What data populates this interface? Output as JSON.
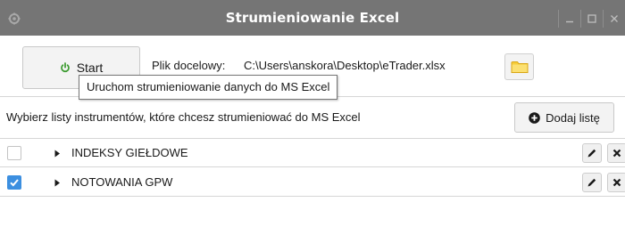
{
  "window": {
    "title": "Strumieniowanie Excel",
    "icon": "gear-icon",
    "controls": [
      "minimize-icon",
      "maximize-icon",
      "close-icon"
    ]
  },
  "toolbar": {
    "start_label": "Start",
    "start_icon": "power-icon",
    "target_label": "Plik docelowy:",
    "target_path": "C:\\Users\\anskora\\Desktop\\eTrader.xlsx",
    "folder_icon": "folder-icon"
  },
  "tooltip": {
    "text": "Uruchom strumieniowanie danych do MS Excel"
  },
  "lists": {
    "instruction": "Wybierz listy instrumentów, które chcesz strumieniować do MS Excel",
    "add_label": "Dodaj listę",
    "add_icon": "plus-circle-icon",
    "items": [
      {
        "label": "INDEKSY GIEŁDOWE",
        "checked": false
      },
      {
        "label": "NOTOWANIA GPW",
        "checked": true
      }
    ]
  },
  "colors": {
    "titlebar": "#757575",
    "start_icon": "#3a9a2e",
    "checkbox_checked": "#3c8fe0",
    "folder": "#f2c230"
  }
}
